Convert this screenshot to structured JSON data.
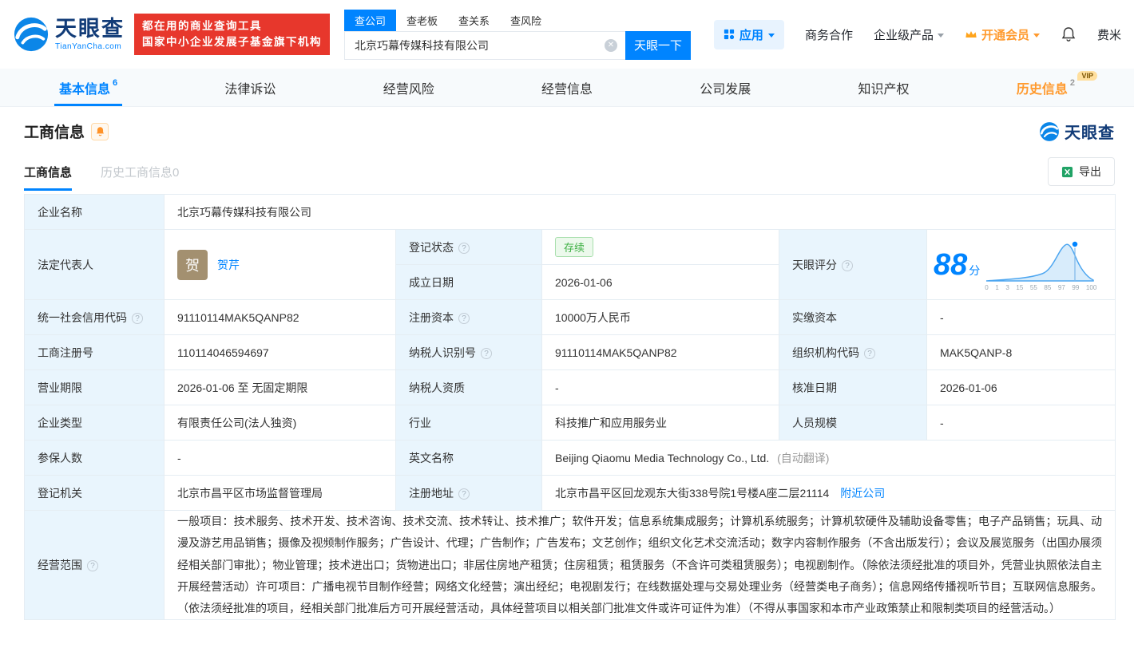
{
  "header": {
    "logo": {
      "name_cn": "天眼查",
      "name_en": "TianYanCha.com"
    },
    "slogan": {
      "line1": "都在用的商业查询工具",
      "line2": "国家中小企业发展子基金旗下机构"
    },
    "search": {
      "tabs": [
        {
          "label": "查公司"
        },
        {
          "label": "查老板"
        },
        {
          "label": "查关系"
        },
        {
          "label": "查风险"
        }
      ],
      "value": "北京巧幕传媒科技有限公司",
      "button": "天眼一下"
    },
    "menu": {
      "apps": "应用",
      "biz": "商务合作",
      "enterprise": "企业级产品",
      "vip": "开通会员",
      "user": "费米"
    }
  },
  "nav": {
    "tabs": [
      {
        "label": "基本信息",
        "count": "6"
      },
      {
        "label": "法律诉讼",
        "count": ""
      },
      {
        "label": "经营风险",
        "count": ""
      },
      {
        "label": "经营信息",
        "count": ""
      },
      {
        "label": "公司发展",
        "count": ""
      },
      {
        "label": "知识产权",
        "count": ""
      },
      {
        "label": "历史信息",
        "count": "2",
        "badge": "VIP"
      }
    ]
  },
  "section": {
    "title": "工商信息",
    "brand": "天眼查",
    "subtab_active": "工商信息",
    "subtab_history": "历史工商信息0",
    "export_label": "导出"
  },
  "fields": {
    "company_name": {
      "label": "企业名称",
      "value": "北京巧幕传媒科技有限公司"
    },
    "legal_rep": {
      "label": "法定代表人",
      "avatar": "贺",
      "name": "贺芹"
    },
    "reg_status": {
      "label": "登记状态",
      "value": "存续"
    },
    "est_date": {
      "label": "成立日期",
      "value": "2026-01-06"
    },
    "score": {
      "label": "天眼评分",
      "value": "88",
      "unit": "分",
      "ticks": [
        "0",
        "1",
        "3",
        "15",
        "55",
        "85",
        "97",
        "99",
        "100"
      ]
    },
    "credit_code": {
      "label": "统一社会信用代码",
      "value": "91110114MAK5QANP82"
    },
    "reg_capital": {
      "label": "注册资本",
      "value": "10000万人民币"
    },
    "paid_capital": {
      "label": "实缴资本",
      "value": "-"
    },
    "reg_no": {
      "label": "工商注册号",
      "value": "110114046594697"
    },
    "taxpayer_no": {
      "label": "纳税人识别号",
      "value": "91110114MAK5QANP82"
    },
    "org_code": {
      "label": "组织机构代码",
      "value": "MAK5QANP-8"
    },
    "term": {
      "label": "营业期限",
      "value": "2026-01-06 至 无固定期限"
    },
    "taxpayer_quality": {
      "label": "纳税人资质",
      "value": "-"
    },
    "approve_date": {
      "label": "核准日期",
      "value": "2026-01-06"
    },
    "company_type": {
      "label": "企业类型",
      "value": "有限责任公司(法人独资)"
    },
    "industry": {
      "label": "行业",
      "value": "科技推广和应用服务业"
    },
    "staff_size": {
      "label": "人员规模",
      "value": "-"
    },
    "insured": {
      "label": "参保人数",
      "value": "-"
    },
    "en_name": {
      "label": "英文名称",
      "value": "Beijing Qiaomu Media Technology Co., Ltd.",
      "note": "(自动翻译)"
    },
    "reg_authority": {
      "label": "登记机关",
      "value": "北京市昌平区市场监督管理局"
    },
    "address": {
      "label": "注册地址",
      "value": "北京市昌平区回龙观东大街338号院1号楼A座二层21114",
      "link": "附近公司"
    },
    "scope": {
      "label": "经营范围",
      "value": "一般项目：技术服务、技术开发、技术咨询、技术交流、技术转让、技术推广；软件开发；信息系统集成服务；计算机系统服务；计算机软硬件及辅助设备零售；电子产品销售；玩具、动漫及游艺用品销售；摄像及视频制作服务；广告设计、代理；广告制作；广告发布；文艺创作；组织文化艺术交流活动；数字内容制作服务（不含出版发行）；会议及展览服务（出国办展须经相关部门审批）；物业管理；技术进出口；货物进出口；非居住房地产租赁；住房租赁；租赁服务（不含许可类租赁服务）；电视剧制作。（除依法须经批准的项目外，凭营业执照依法自主开展经营活动）许可项目：广播电视节目制作经营；网络文化经营；演出经纪；电视剧发行；在线数据处理与交易处理业务（经营类电子商务）；信息网络传播视听节目；互联网信息服务。（依法须经批准的项目，经相关部门批准后方可开展经营活动，具体经营项目以相关部门批准文件或许可证件为准）（不得从事国家和本市产业政策禁止和限制类项目的经营活动。）"
    }
  }
}
